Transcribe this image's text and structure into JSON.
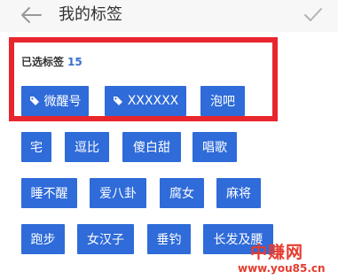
{
  "header": {
    "title": "我的标签"
  },
  "selected": {
    "label": "已选标签",
    "count": "15",
    "tags": [
      "微醒号",
      "XXXXXX",
      "泡吧"
    ]
  },
  "available": {
    "rows": [
      [
        "宅",
        "逗比",
        "傻白甜",
        "唱歌"
      ],
      [
        "睡不醒",
        "爱八卦",
        "腐女",
        "麻将"
      ],
      [
        "跑步",
        "女汉子",
        "垂钓",
        "长发及腰"
      ]
    ]
  },
  "watermark": {
    "name": "中赚网",
    "url": "www.you85.cn"
  },
  "colors": {
    "chip": "#2f6bd9",
    "highlight": "#e8262d",
    "count": "#3a6fd0",
    "watermark": "#e53b2f"
  }
}
